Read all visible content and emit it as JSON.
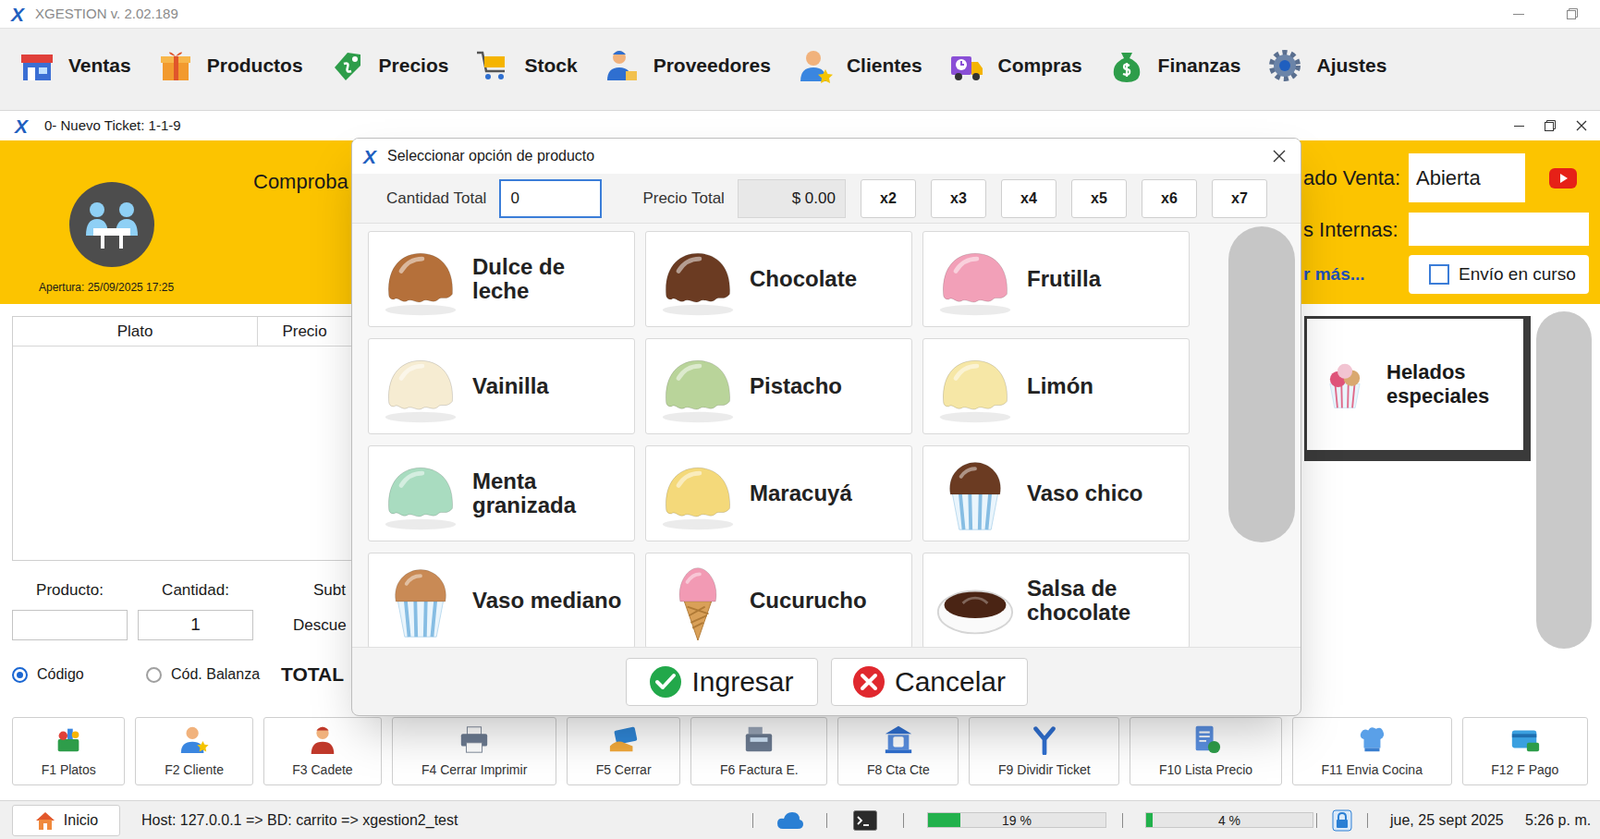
{
  "app": {
    "logo": "X",
    "title": "XGESTION v. 2.02.189"
  },
  "menu": [
    {
      "label": "Ventas"
    },
    {
      "label": "Productos"
    },
    {
      "label": "Precios"
    },
    {
      "label": "Stock"
    },
    {
      "label": "Proveedores"
    },
    {
      "label": "Clientes"
    },
    {
      "label": "Compras"
    },
    {
      "label": "Finanzas"
    },
    {
      "label": "Ajustes"
    }
  ],
  "ticket_window": {
    "title": "0- Nuevo Ticket: 1-1-9"
  },
  "header": {
    "comprobante_label": "Comproba",
    "apertura": "Apertura: 25/09/2025 17:25",
    "estado_label": "ado Venta:",
    "estado_value": "Abierta",
    "notas_label": "s Internas:",
    "notas_value": "",
    "ver_mas": "r más...",
    "envio": {
      "label": "Envío en curso",
      "checked": false
    }
  },
  "table": {
    "columns": [
      "Plato",
      "Precio"
    ],
    "rows": []
  },
  "entry": {
    "producto_label": "Producto:",
    "cantidad_label": "Cantidad:",
    "subtotal_label": "Subt",
    "descuento_label": "Descue",
    "producto_value": "",
    "cantidad_value": "1",
    "total_label": "TOTAL",
    "code_modes": [
      {
        "label": "Código",
        "selected": true
      },
      {
        "label": "Cód. Balanza",
        "selected": false
      }
    ]
  },
  "categories": [
    {
      "label": "Helados especiales",
      "selected": true
    }
  ],
  "function_keys": [
    {
      "label": "F1 Platos"
    },
    {
      "label": "F2 Cliente"
    },
    {
      "label": "F3 Cadete"
    },
    {
      "label": "F4 Cerrar Imprimir"
    },
    {
      "label": "F5 Cerrar"
    },
    {
      "label": "F6 Factura E."
    },
    {
      "label": "F8 Cta Cte"
    },
    {
      "label": "F9 Dividir Ticket"
    },
    {
      "label": "F10 Lista Precio"
    },
    {
      "label": "F11 Envia Cocina"
    },
    {
      "label": "F12 F Pago"
    }
  ],
  "status_bar": {
    "home": "Inicio",
    "host": "Host: 127.0.0.1 => BD: carrito => xgestion2_test",
    "meters": [
      {
        "level": 0.18,
        "reading": "19 %"
      },
      {
        "level": 0.04,
        "reading": "4 %"
      }
    ],
    "date": "jue, 25 sept 2025",
    "time": "5:26 p. m."
  },
  "dialog": {
    "title": "Seleccionar opción de producto",
    "cantidad_label": "Cantidad Total",
    "cantidad_value": "0",
    "cantidad_focused": true,
    "precio_label": "Precio Total",
    "precio_value": "$ 0.00",
    "multipliers": [
      "x2",
      "x3",
      "x4",
      "x5",
      "x6",
      "x7"
    ],
    "products": [
      {
        "label": "Dulce de leche",
        "kind": "scoop",
        "color": "#b5703a"
      },
      {
        "label": "Chocolate",
        "kind": "scoop",
        "color": "#6b3b22"
      },
      {
        "label": "Frutilla",
        "kind": "scoop",
        "color": "#f2a0b8"
      },
      {
        "label": "Vainilla",
        "kind": "scoop",
        "color": "#f6ecd2"
      },
      {
        "label": "Pistacho",
        "kind": "scoop",
        "color": "#b9d49a"
      },
      {
        "label": "Limón",
        "kind": "scoop",
        "color": "#f6e7a6"
      },
      {
        "label": "Menta granizada",
        "kind": "scoop",
        "color": "#a9dcc0"
      },
      {
        "label": "Maracuyá",
        "kind": "scoop",
        "color": "#f4d97a"
      },
      {
        "label": "Vaso chico",
        "kind": "cup",
        "color": "#6b3b22"
      },
      {
        "label": "Vaso mediano",
        "kind": "cup",
        "color": "#c98a55"
      },
      {
        "label": "Cucurucho",
        "kind": "cone",
        "color": "#f29ab4"
      },
      {
        "label": "Salsa de chocolate",
        "kind": "sauce",
        "color": "#4a2414"
      }
    ],
    "buttons": {
      "ok": "Ingresar",
      "cancel": "Cancelar"
    }
  }
}
